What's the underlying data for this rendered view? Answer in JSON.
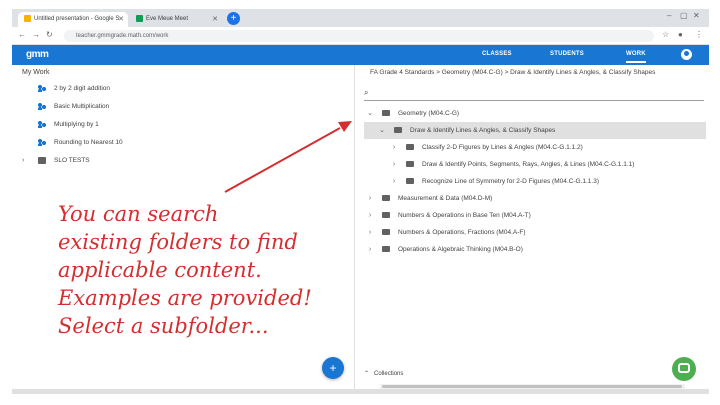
{
  "browser": {
    "tabs": [
      {
        "label": "Untitled presentation - Google S",
        "favicon_color": "#f4b400",
        "active": true
      },
      {
        "label": "Eve Meue Meet",
        "favicon_color": "#0f9d58",
        "active": false
      }
    ],
    "url": "teacher.gmmgrade.math.com/work"
  },
  "app": {
    "logo": "gmm",
    "nav": [
      "CLASSES",
      "STUDENTS",
      "WORK"
    ],
    "active_nav": "WORK",
    "accent": "#1976d2"
  },
  "left": {
    "title": "My Work",
    "items": [
      {
        "label": "2 by 2 digit addition",
        "type": "lesson"
      },
      {
        "label": "Basic Multiplication",
        "type": "lesson"
      },
      {
        "label": "Multiplying by 1",
        "type": "lesson"
      },
      {
        "label": "Rounding to Nearest 10",
        "type": "lesson"
      },
      {
        "label": "SLO TESTS",
        "type": "folder"
      }
    ],
    "fab": "+"
  },
  "right": {
    "breadcrumb": "FA Grade 4 Standards  >  Geometry (M04.C-G)  >  Draw & Identify Lines & Angles, & Classify Shapes",
    "tree": [
      {
        "label": "Geometry (M04.C-G)",
        "depth": 0,
        "expanded": true,
        "selected": false
      },
      {
        "label": "Draw & Identify Lines & Angles, & Classify Shapes",
        "depth": 1,
        "expanded": true,
        "selected": true
      },
      {
        "label": "Classify 2-D Figures by Lines & Angles (M04.C-G.1.1.2)",
        "depth": 2,
        "expanded": false,
        "selected": false
      },
      {
        "label": "Draw & Identify Points, Segments, Rays, Angles, & Lines (M04.C-G.1.1.1)",
        "depth": 2,
        "expanded": false,
        "selected": false
      },
      {
        "label": "Recognize Line of Symmetry for 2-D Figures (M04.C-G.1.1.3)",
        "depth": 2,
        "expanded": false,
        "selected": false
      },
      {
        "label": "Measurement & Data (M04.D-M)",
        "depth": 0,
        "expanded": false,
        "selected": false
      },
      {
        "label": "Numbers & Operations in Base Ten (M04.A-T)",
        "depth": 0,
        "expanded": false,
        "selected": false
      },
      {
        "label": "Numbers & Operations, Fractions (M04.A-F)",
        "depth": 0,
        "expanded": false,
        "selected": false
      },
      {
        "label": "Operations & Algebraic Thinking (M04.B-O)",
        "depth": 0,
        "expanded": false,
        "selected": false
      }
    ],
    "collections": "Collections"
  },
  "annotation": {
    "lines": [
      "You can search",
      "existing folders to find",
      "applicable content.",
      "Examples are provided!",
      "Select a subfolder..."
    ],
    "color": "#d32f2f"
  }
}
